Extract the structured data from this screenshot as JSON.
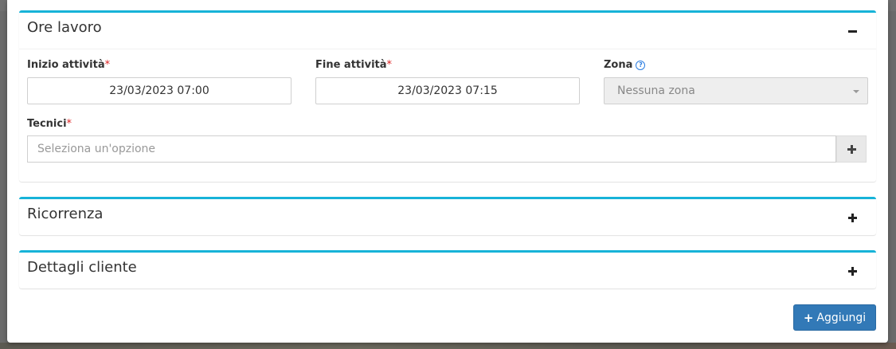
{
  "sections": {
    "ore_lavoro": {
      "title": "Ore lavoro",
      "collapse_icon": "minus-icon",
      "fields": {
        "inizio": {
          "label": "Inizio attività",
          "required_mark": "*",
          "value": "23/03/2023 07:00"
        },
        "fine": {
          "label": "Fine attività",
          "required_mark": "*",
          "value": "23/03/2023 07:15"
        },
        "zona": {
          "label": "Zona",
          "help_icon": "?",
          "value": "Nessuna zona"
        },
        "tecnici": {
          "label": "Tecnici",
          "required_mark": "*",
          "placeholder": "Seleziona un'opzione",
          "add_icon": "plus-icon"
        }
      }
    },
    "ricorrenza": {
      "title": "Ricorrenza",
      "expand_icon": "plus-icon"
    },
    "dettagli_cliente": {
      "title": "Dettagli cliente",
      "expand_icon": "plus-icon"
    }
  },
  "footer": {
    "add_button": {
      "icon": "+",
      "label": "Aggiungi"
    }
  },
  "colors": {
    "box_accent": "#17b3d8",
    "primary_button": "#3279b7",
    "required": "#dd2222",
    "help": "#2a7de1"
  }
}
